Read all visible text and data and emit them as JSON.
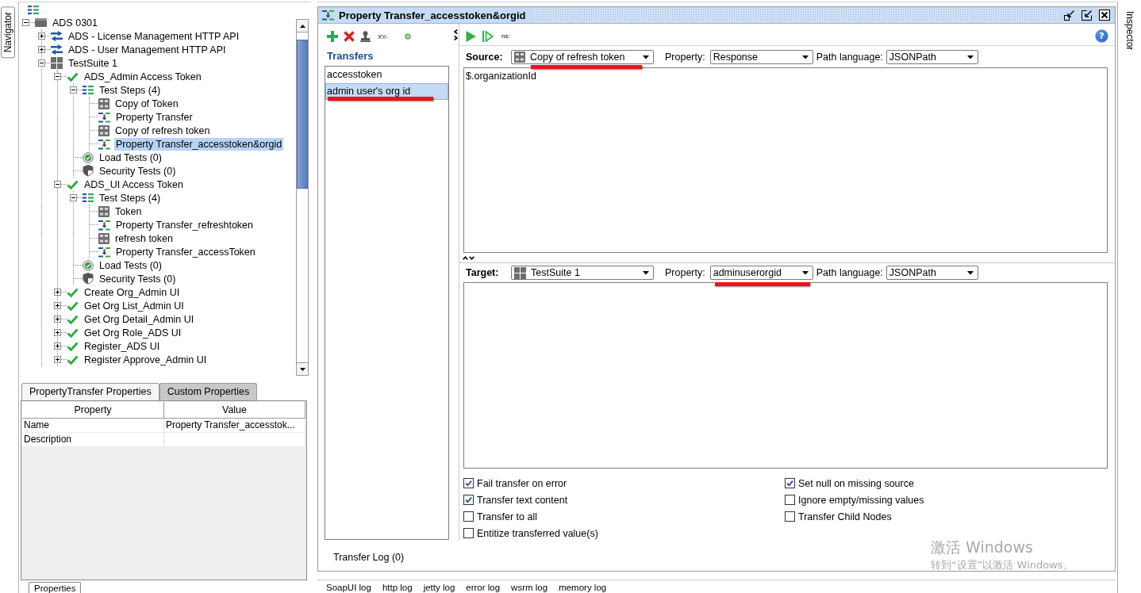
{
  "navigator": {
    "label": "Navigator"
  },
  "tree": {
    "items": [
      {
        "label": "ADS 0301",
        "kind": "project",
        "expanded": true,
        "selected": false,
        "children": [
          {
            "label": "ADS - License Management HTTP API",
            "kind": "interface",
            "expanded": false,
            "selected": false
          },
          {
            "label": "ADS - User Management HTTP API",
            "kind": "interface",
            "expanded": false,
            "selected": false
          },
          {
            "label": "TestSuite 1",
            "kind": "suite",
            "expanded": true,
            "selected": false,
            "children": [
              {
                "label": "ADS_Admin Access Token",
                "kind": "testcase",
                "expanded": true,
                "selected": false,
                "children": [
                  {
                    "label": "Test Steps (4)",
                    "kind": "steps",
                    "expanded": true,
                    "selected": false,
                    "children": [
                      {
                        "label": "Copy of Token",
                        "kind": "rest",
                        "selected": false
                      },
                      {
                        "label": "Property Transfer",
                        "kind": "transfer",
                        "selected": false
                      },
                      {
                        "label": "Copy of refresh token",
                        "kind": "rest",
                        "selected": false
                      },
                      {
                        "label": "Property Transfer_accesstoken&orgid",
                        "kind": "transfer",
                        "selected": true
                      }
                    ]
                  },
                  {
                    "label": "Load Tests (0)",
                    "kind": "load",
                    "selected": false
                  },
                  {
                    "label": "Security Tests (0)",
                    "kind": "security",
                    "selected": false
                  }
                ]
              },
              {
                "label": "ADS_UI Access Token",
                "kind": "testcase",
                "expanded": true,
                "selected": false,
                "children": [
                  {
                    "label": "Test Steps (4)",
                    "kind": "steps",
                    "expanded": true,
                    "selected": false,
                    "children": [
                      {
                        "label": "Token",
                        "kind": "rest",
                        "selected": false
                      },
                      {
                        "label": "Property Transfer_refreshtoken",
                        "kind": "transfer",
                        "selected": false
                      },
                      {
                        "label": "refresh token",
                        "kind": "rest",
                        "selected": false
                      },
                      {
                        "label": "Property Transfer_accessToken",
                        "kind": "transfer",
                        "selected": false
                      }
                    ]
                  },
                  {
                    "label": "Load Tests (0)",
                    "kind": "load",
                    "selected": false
                  },
                  {
                    "label": "Security Tests (0)",
                    "kind": "security",
                    "selected": false
                  }
                ]
              },
              {
                "label": "Create Org_Admin UI",
                "kind": "testcase",
                "expanded": false,
                "selected": false
              },
              {
                "label": "Get Org List_Admin UI",
                "kind": "testcase",
                "expanded": false,
                "selected": false
              },
              {
                "label": "Get Org Detail_Admin UI",
                "kind": "testcase",
                "expanded": false,
                "selected": false
              },
              {
                "label": "Get Org Role_ADS UI",
                "kind": "testcase",
                "expanded": false,
                "selected": false
              },
              {
                "label": "Register_ADS UI",
                "kind": "testcase",
                "expanded": false,
                "selected": false
              },
              {
                "label": "Register Approve_Admin UI",
                "kind": "testcase",
                "expanded": false,
                "selected": false
              }
            ]
          }
        ]
      }
    ]
  },
  "props": {
    "tabs": [
      {
        "label": "PropertyTransfer Properties",
        "selected": true
      },
      {
        "label": "Custom Properties",
        "selected": false
      }
    ],
    "columns": [
      "Property",
      "Value"
    ],
    "rows": [
      {
        "property": "Name",
        "value": "Property Transfer_accesstok..."
      },
      {
        "property": "Description"
      }
    ]
  },
  "properties_tab": {
    "label": "Properties"
  },
  "editor": {
    "title": "Property Transfer_accesstoken&orgid",
    "transfers_toolbar": {
      "xy_label": "XY-"
    },
    "transfers_heading": "Transfers",
    "transfers": [
      {
        "name": "accesstoken",
        "selected": false,
        "underlined": false
      },
      {
        "name": "admin user's org id",
        "selected": true,
        "underlined": true
      }
    ],
    "run_toolbar": {
      "ns_label": "ns:",
      "help_label": "?"
    },
    "source": {
      "label": "Source:",
      "step": {
        "value": "Copy of refresh token",
        "kind": "rest",
        "underlined": true
      },
      "property_label": "Property:",
      "property": {
        "value": "Response"
      },
      "path_language_label": "Path language:",
      "path_language": {
        "value": "JSONPath"
      },
      "expression": "$.organizationId"
    },
    "target": {
      "label": "Target:",
      "step": {
        "value": "TestSuite 1",
        "kind": "suite"
      },
      "property_label": "Property:",
      "property": {
        "value": "adminuserorgid",
        "underlined": true
      },
      "path_language_label": "Path language:",
      "path_language": {
        "value": "JSONPath"
      }
    },
    "options": {
      "column_1": [
        {
          "label": "Fail transfer on error",
          "checked": true
        },
        {
          "label": "Transfer text content",
          "checked": true
        },
        {
          "label": "Transfer to all",
          "checked": false
        },
        {
          "label": "Entitize transferred value(s)",
          "checked": false
        }
      ],
      "column_2": [
        {
          "label": "Set null on missing source",
          "checked": true
        },
        {
          "label": "Ignore empty/missing values",
          "checked": false
        },
        {
          "label": "Transfer Child Nodes",
          "checked": false
        }
      ]
    },
    "log_tab": {
      "label": "Transfer Log (0)"
    }
  },
  "log_tabs": [
    {
      "label": "SoapUI log"
    },
    {
      "label": "http log"
    },
    {
      "label": "jetty log"
    },
    {
      "label": "error log"
    },
    {
      "label": "wsrm log"
    },
    {
      "label": "memory log"
    }
  ],
  "inspector": {
    "label": "Inspector"
  },
  "os_notice": {
    "title": "激活 Windows",
    "text": "转到“设置”以激活 Windows。"
  }
}
